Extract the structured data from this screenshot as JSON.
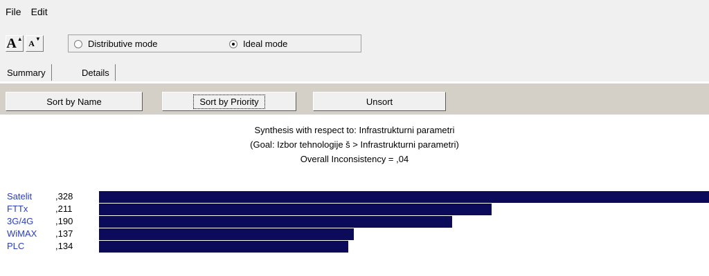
{
  "menu": {
    "file": "File",
    "edit": "Edit"
  },
  "toolbar": {
    "font_big": "A",
    "font_small": "A",
    "mode_distributive": "Distributive mode",
    "mode_ideal": "Ideal mode",
    "selected_mode": "ideal"
  },
  "tabs": {
    "summary": "Summary",
    "details": "Details"
  },
  "sort": {
    "by_name": "Sort by Name",
    "by_priority": "Sort by Priority",
    "unsort": "Unsort"
  },
  "synthesis": {
    "line1": "Synthesis with respect to: Infrastrukturni parametri",
    "line2": "(Goal: Izbor tehnologije š > Infrastrukturni parametri)",
    "line3": "Overall Inconsistency = ,04"
  },
  "colors": {
    "bar": "#0b0b5a",
    "label": "#2a3cbd"
  },
  "chart_data": {
    "type": "bar",
    "categories": [
      "Satelit",
      "FTTx",
      "3G/4G",
      "WiMAX",
      "PLC"
    ],
    "labels": [
      ",328",
      ",211",
      ",190",
      ",137",
      ",134"
    ],
    "values": [
      0.328,
      0.211,
      0.19,
      0.137,
      0.134
    ],
    "xlim": [
      0,
      0.328
    ]
  }
}
